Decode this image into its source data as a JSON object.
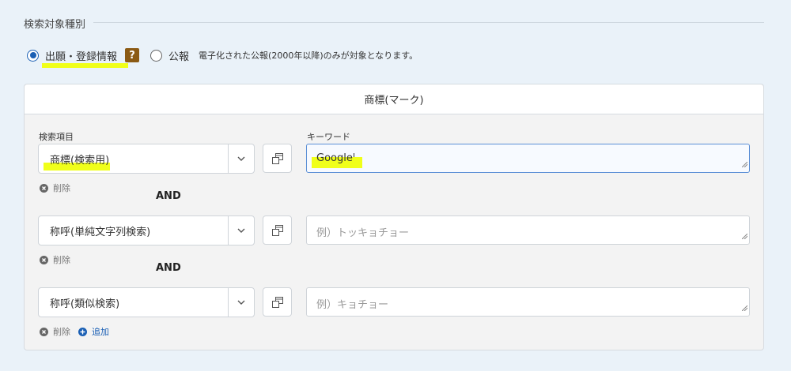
{
  "section": {
    "title": "検索対象種別"
  },
  "radios": {
    "option1": {
      "label": "出願・登録情報",
      "checked": true,
      "help": "?"
    },
    "option2": {
      "label": "公報",
      "checked": false
    },
    "note": "電子化された公報(2000年以降)のみが対象となります。"
  },
  "card": {
    "title": "商標(マーク)",
    "search_item_label": "検索項目",
    "keyword_label": "キーワード",
    "rows": [
      {
        "select_value": "商標(検索用)",
        "keyword_value": "Google",
        "keyword_placeholder": "",
        "delete_label": "削除"
      },
      {
        "select_value": "称呼(単純文字列検索)",
        "keyword_value": "",
        "keyword_placeholder": "例）トッキョチョー",
        "delete_label": "削除"
      },
      {
        "select_value": "称呼(類似検索)",
        "keyword_value": "",
        "keyword_placeholder": "例）キョチョー",
        "delete_label": "削除"
      }
    ],
    "operators": [
      "AND",
      "AND"
    ],
    "add_label": "追加"
  },
  "colors": {
    "accent": "#1a5fb4",
    "highlight": "#f0ff1a",
    "help_badge": "#8b5a14"
  }
}
